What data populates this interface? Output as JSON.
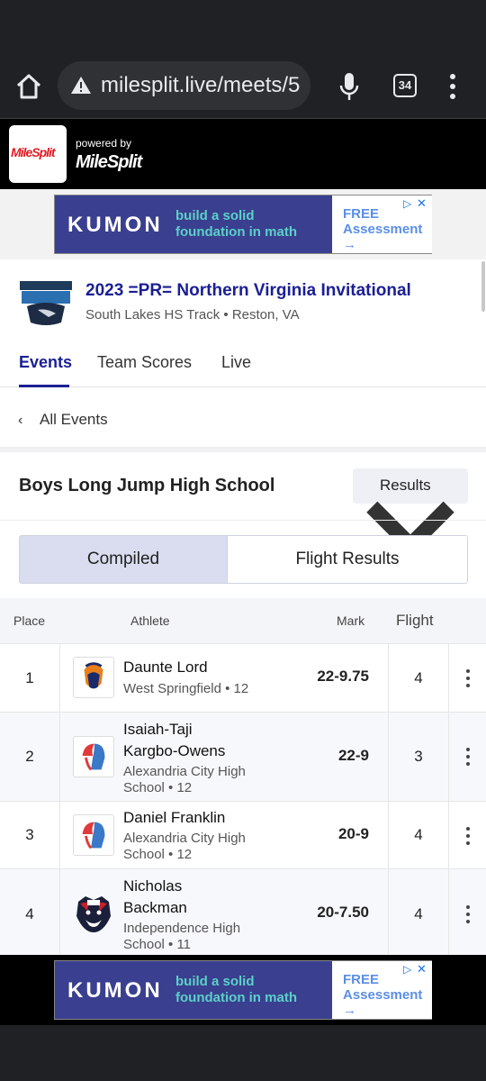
{
  "browser": {
    "url": "milesplit.live/meets/5",
    "tab_count": "34"
  },
  "header": {
    "logo_text": "MileSplit",
    "powered_by": "powered by",
    "powered_logo": "MileSplit"
  },
  "ad": {
    "brand": "KUMON",
    "tagline_line1": "build a solid",
    "tagline_line2": "foundation in math",
    "cta_line1": "FREE",
    "cta_line2": "Assessment",
    "cta_arrow": "→"
  },
  "meet": {
    "title": "2023 =PR= Northern Virginia Invitational",
    "subtitle": "South Lakes HS Track • Reston, VA"
  },
  "tabs": [
    {
      "label": "Events"
    },
    {
      "label": "Team Scores"
    },
    {
      "label": "Live"
    }
  ],
  "all_events_label": "All Events",
  "event": {
    "title": "Boys Long Jump High School",
    "view_select": "Results"
  },
  "segments": {
    "compiled": "Compiled",
    "flight": "Flight Results"
  },
  "table": {
    "headers": {
      "place": "Place",
      "athlete": "Athlete",
      "mark": "Mark",
      "flight": "Flight"
    },
    "rows": [
      {
        "place": "1",
        "name": "Daunte Lord",
        "team": "West Springfield • 12",
        "mark": "22-9.75",
        "flight": "4",
        "logo": "spartan-orange"
      },
      {
        "place": "2",
        "name_line1": "Isaiah-Taji",
        "name_line2": "Kargbo-Owens",
        "team_line1": "Alexandria City High",
        "team_line2": "School • 12",
        "mark": "22-9",
        "flight": "3",
        "logo": "titan-red-blue"
      },
      {
        "place": "3",
        "name": "Daniel Franklin",
        "team_line1": "Alexandria City High",
        "team_line2": "School • 12",
        "mark": "20-9",
        "flight": "4",
        "logo": "titan-red-blue"
      },
      {
        "place": "4",
        "name_line1": "Nicholas",
        "name_line2": "Backman",
        "team_line1": "Independence High",
        "team_line2": "School • 11",
        "mark": "20-7.50",
        "flight": "4",
        "logo": "tiger-flag"
      }
    ]
  },
  "colors": {
    "brand_navy": "#1b1f94",
    "milesplit_red": "#e21b22",
    "ad_purple": "#3a3f8f",
    "ad_teal": "#5cd0c8"
  }
}
